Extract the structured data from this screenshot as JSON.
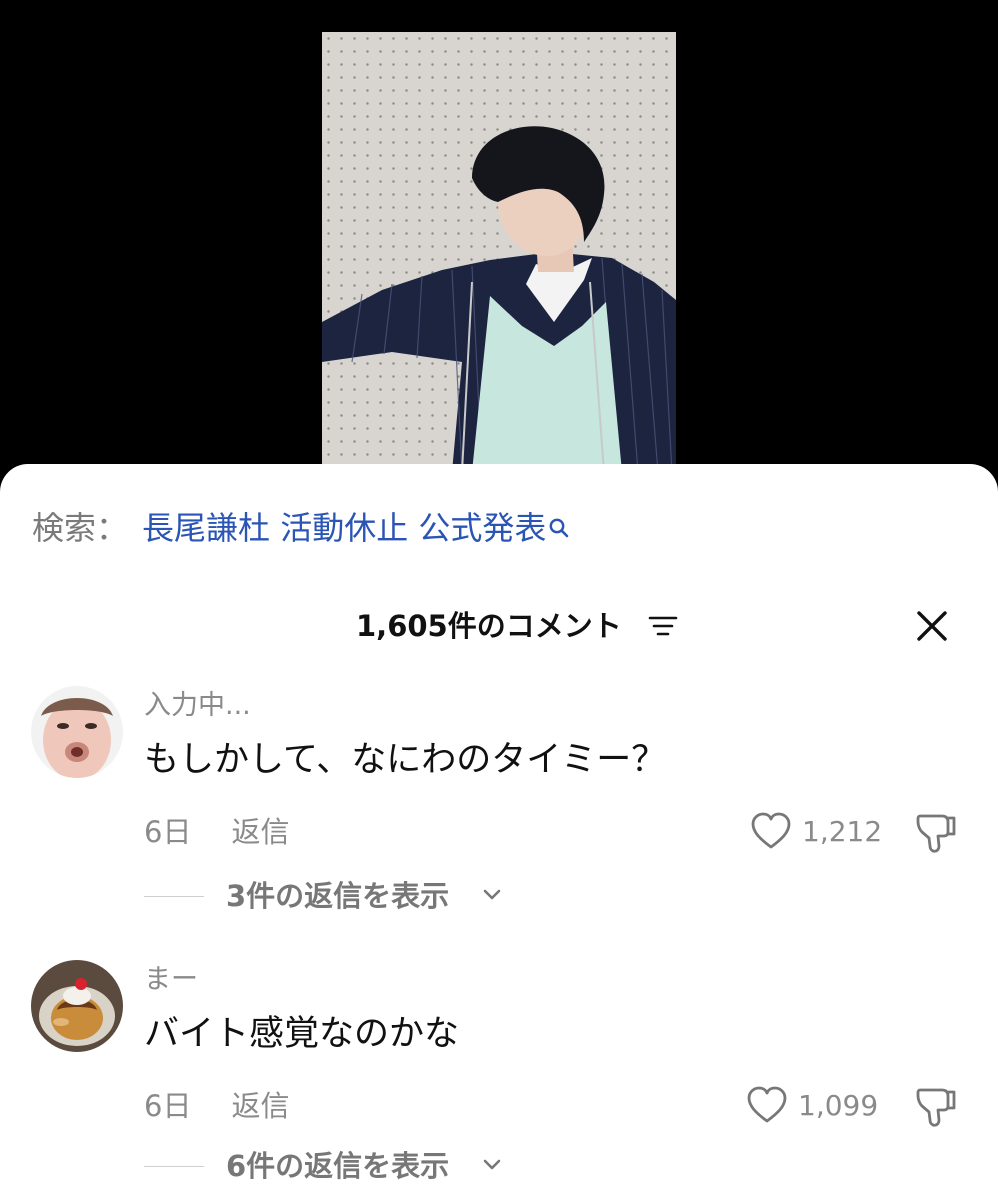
{
  "search": {
    "prefix": "検索：",
    "query": "長尾謙杜 活動休止 公式発表"
  },
  "header": {
    "comment_count": "1,605件のコメント"
  },
  "comments": [
    {
      "username": "入力中...",
      "text": "もしかして、なにわのタイミー？",
      "time": "6日",
      "reply_label": "返信",
      "likes": "1,212",
      "view_replies": "3件の返信を表示"
    },
    {
      "username": "まー",
      "text": "バイト感覚なのかな",
      "time": "6日",
      "reply_label": "返信",
      "likes": "1,099",
      "view_replies": "6件の返信を表示"
    }
  ],
  "colors": {
    "link": "#2b55b5",
    "muted": "#8a8a8a",
    "text": "#111111",
    "sheet_bg": "#ffffff",
    "video_bg": "#000000"
  },
  "icons": {
    "search": "search-icon",
    "sort": "sort-icon",
    "close": "close-icon",
    "like": "heart-icon",
    "dislike": "dislike-icon",
    "expand": "chevron-down-icon"
  }
}
